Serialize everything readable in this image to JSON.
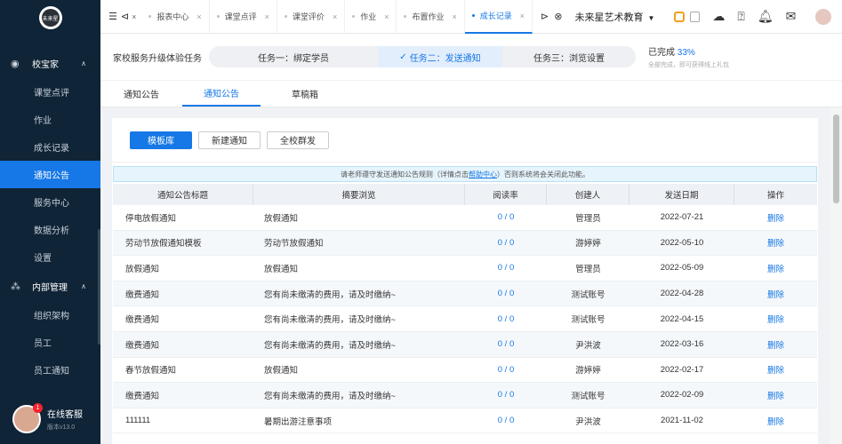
{
  "sidebar": {
    "logo_text": "未来星",
    "group1": {
      "label": "校宝家"
    },
    "items1": [
      {
        "label": "课堂点评"
      },
      {
        "label": "作业"
      },
      {
        "label": "成长记录"
      },
      {
        "label": "通知公告",
        "active": true
      },
      {
        "label": "服务中心"
      },
      {
        "label": "数据分析"
      },
      {
        "label": "设置"
      }
    ],
    "group2": {
      "label": "内部管理"
    },
    "items2": [
      {
        "label": "组织架构"
      },
      {
        "label": "员工"
      },
      {
        "label": "员工通知"
      }
    ],
    "support": {
      "label": "在线客服",
      "version": "版本v13.0",
      "badge": "1"
    }
  },
  "topbar": {
    "tabs": [
      {
        "label": "报表中心"
      },
      {
        "label": "课堂点评"
      },
      {
        "label": "课堂评价"
      },
      {
        "label": "作业"
      },
      {
        "label": "布置作业"
      },
      {
        "label": "成长记录",
        "active": true
      }
    ],
    "org_name": "未来星艺术教育"
  },
  "taskbar": {
    "title": "家校服务升级体验任务",
    "steps": [
      "任务一：绑定学员",
      "任务二：发送通知",
      "任务三：浏览设置"
    ],
    "progress_label": "已完成",
    "progress_value": "33%",
    "progress_hint": "全部完成，即可获得线上礼包"
  },
  "subtabs": [
    "通知公告",
    "通知公告",
    "草稿箱"
  ],
  "buttons": {
    "template": "模板库",
    "new": "新建通知",
    "broadcast": "全校群发"
  },
  "notice": {
    "before": "请老师遵守发送通知公告规则（详情点击",
    "link": "帮助中心",
    "after": "）否则系统将会关闭此功能。"
  },
  "table": {
    "headers": [
      "通知公告标题",
      "摘要浏览",
      "阅读率",
      "创建人",
      "发送日期",
      "操作"
    ],
    "rows": [
      [
        "停电放假通知",
        "放假通知",
        "0 / 0",
        "管理员",
        "2022-07-21",
        "删除"
      ],
      [
        "劳动节放假通知模板",
        "劳动节放假通知",
        "0 / 0",
        "游婷婷",
        "2022-05-10",
        "删除"
      ],
      [
        "放假通知",
        "放假通知",
        "0 / 0",
        "管理员",
        "2022-05-09",
        "删除"
      ],
      [
        "缴费通知",
        "您有尚未缴清的费用，请及时缴纳~",
        "0 / 0",
        "测试账号",
        "2022-04-28",
        "删除"
      ],
      [
        "缴费通知",
        "您有尚未缴清的费用，请及时缴纳~",
        "0 / 0",
        "测试账号",
        "2022-04-15",
        "删除"
      ],
      [
        "缴费通知",
        "您有尚未缴清的费用，请及时缴纳~",
        "0 / 0",
        "尹洪波",
        "2022-03-16",
        "删除"
      ],
      [
        "春节放假通知",
        "放假通知",
        "0 / 0",
        "游婷婷",
        "2022-02-17",
        "删除"
      ],
      [
        "缴费通知",
        "您有尚未缴清的费用，请及时缴纳~",
        "0 / 0",
        "测试账号",
        "2022-02-09",
        "删除"
      ],
      [
        "111111",
        "暑期出游注意事项",
        "0 / 0",
        "尹洪波",
        "2021-11-02",
        "删除"
      ]
    ]
  }
}
